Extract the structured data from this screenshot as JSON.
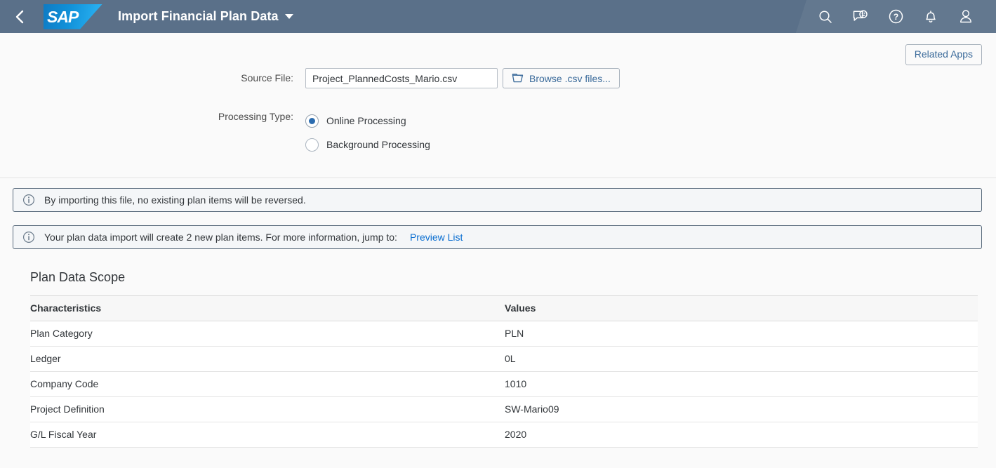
{
  "shell": {
    "back_icon": "chevron-left-icon",
    "logo_text": "SAP",
    "title": "Import Financial Plan Data",
    "title_caret": "chevron-down-icon",
    "actions": [
      {
        "name": "search-icon",
        "label": "Search"
      },
      {
        "name": "feedback-icon",
        "label": "Feedback"
      },
      {
        "name": "help-icon",
        "label": "Help"
      },
      {
        "name": "notifications-icon",
        "label": "Notifications"
      },
      {
        "name": "user-avatar-icon",
        "label": "User"
      }
    ],
    "header_color": "#5a7089"
  },
  "toolbar": {
    "related_apps_label": "Related Apps"
  },
  "form": {
    "source_file": {
      "label": "Source File:",
      "value": "Project_PlannedCosts_Mario.csv",
      "placeholder": "",
      "browse_label": "Browse .csv files...",
      "browse_icon": "open-folder-icon"
    },
    "processing_type": {
      "label": "Processing Type:",
      "selected": "Online Processing",
      "options": [
        {
          "label": "Online Processing",
          "selected": true
        },
        {
          "label": "Background Processing",
          "selected": false
        }
      ]
    }
  },
  "messages": [
    {
      "icon": "information-icon",
      "text": "By importing this file, no existing plan items will be reversed.",
      "link": ""
    },
    {
      "icon": "information-icon",
      "text": "Your plan data import will create 2 new plan items. For more information, jump to:",
      "link": "Preview List"
    }
  ],
  "plan_data_scope": {
    "title": "Plan Data Scope",
    "columns": [
      "Characteristics",
      "Values"
    ],
    "rows": [
      {
        "characteristic": "Plan Category",
        "value": "PLN"
      },
      {
        "characteristic": "Ledger",
        "value": "0L"
      },
      {
        "characteristic": "Company Code",
        "value": "1010"
      },
      {
        "characteristic": "Project Definition",
        "value": "SW-Mario09"
      },
      {
        "characteristic": "G/L Fiscal Year",
        "value": "2020"
      }
    ]
  },
  "colors": {
    "shell_bg": "#5a7089",
    "link": "#0a6ed1",
    "button_text": "#3a6a9a",
    "radio_selected": "#2b6caf",
    "page_bg": "#fafafa"
  }
}
